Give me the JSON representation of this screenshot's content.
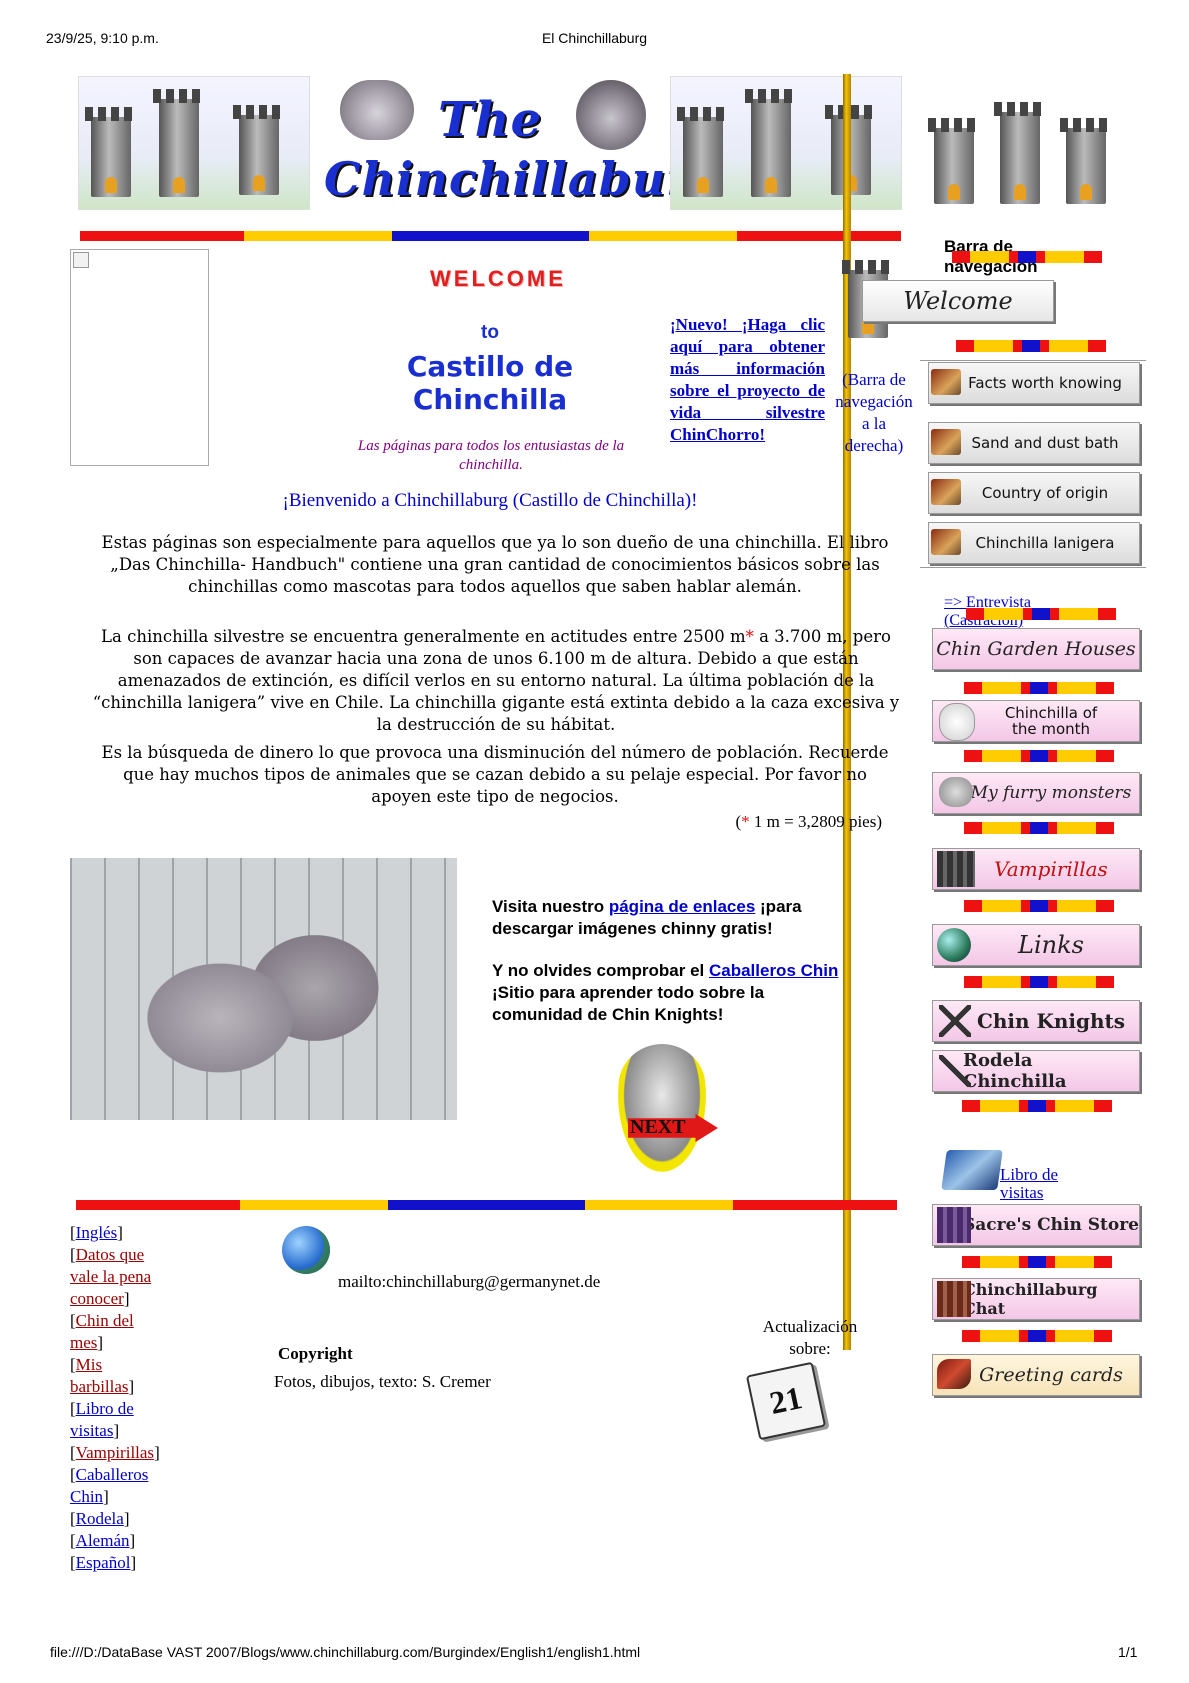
{
  "print": {
    "datetime": "23/9/25, 9:10 p.m.",
    "doc_title": "El Chinchillaburg",
    "url": "file:///D:/DataBase VAST 2007/Blogs/www.chinchillaburg.com/Burgindex/English1/english1.html",
    "page_num": "1/1"
  },
  "header": {
    "logo_line1": "The",
    "logo_line2": "Chinchillaburg"
  },
  "welcome": {
    "banner": "WELCOME",
    "to": "to",
    "castle_title": "Castillo de Chinchilla",
    "tagline": "Las páginas para todos los entusiastas de la chinchilla.",
    "news_link": "¡Nuevo! ¡Haga clic aquí para obtener más información sobre el proyecto de vida silvestre ChinChorro!",
    "nav_note": "(Barra de navegación a la derecha)",
    "greeting": "¡Bienvenido a Chinchillaburg (Castillo de Chinchilla)!"
  },
  "article": {
    "p1": "Estas páginas son especialmente para aquellos que ya lo son dueño de una chinchilla. El libro „Das Chinchilla- Handbuch\" contiene una gran cantidad de conocimientos básicos sobre las chinchillas como mascotas para todos aquellos que saben hablar alemán.",
    "p2_a": "La chinchilla silvestre se encuentra generalmente en actitudes entre 2500 m",
    "asterisk": "*",
    "p2_b": " a 3.700 m, pero son capaces de avanzar hacia una zona de unos 6.100 m de altura. Debido a que están amenazados de extinción, es difícil verlos en su entorno natural. La última población de la “chinchilla lanigera” vive en Chile. La chinchilla gigante está extinta debido a la caza excesiva y la destrucción de su hábitat.",
    "p3": "Es la búsqueda de dinero lo que provoca una disminución del número de población. Recuerde que hay muchos tipos de animales que se cazan debido a su pelaje especial. Por favor no apoyen este tipo de negocios.",
    "footnote_open": "(",
    "footnote_rest": " 1 m = 3,2809 pies)"
  },
  "promo": {
    "visit_prefix": "Visita nuestro ",
    "links_page": "página de enlaces",
    "visit_suffix": " ¡para descargar imágenes chinny gratis!",
    "knights_prefix": "Y no olvides comprobar el ",
    "knights_link": "Caballeros Chin",
    "knights_suffix": " ¡Sitio para aprender todo sobre la comunidad de Chin Knights!",
    "next_label": "NEXT"
  },
  "bottom_nav": [
    {
      "label": "Inglés",
      "visited": false
    },
    {
      "label": "Datos que vale la pena conocer",
      "visited": true
    },
    {
      "label": "Chin del mes",
      "visited": true
    },
    {
      "label": "Mis barbillas",
      "visited": true
    },
    {
      "label": "Libro de visitas",
      "visited": false
    },
    {
      "label": "Vampirillas",
      "visited": true
    },
    {
      "label": "Caballeros Chin",
      "visited": false
    },
    {
      "label": "Rodela",
      "visited": false
    },
    {
      "label": "Alemán",
      "visited": false
    },
    {
      "label": "Español",
      "visited": false
    }
  ],
  "footer": {
    "mailto": "mailto:chinchillaburg@germanynet.de",
    "copyright_label": "Copyright",
    "credits": "Fotos, dibujos, texto: S. Cremer",
    "update_label": "Actualización sobre:",
    "calendar_day": "21"
  },
  "sidebar": {
    "heading": "Barra de navegación",
    "welcome_btn": "Welcome",
    "facts": "Facts worth knowing",
    "sand": "Sand and dust bath",
    "country": "Country of origin",
    "lanigera": "Chinchilla lanigera",
    "interview": "=> Entrevista (Castración)",
    "garden": "Chin Garden Houses",
    "chin_month": "Chinchilla of the month",
    "furry": "My furry monsters",
    "vampirillas": "Vampirillas",
    "links": "Links",
    "knights": "Chin Knights",
    "rodela": "Rodela Chinchilla",
    "guestbook": "Libro de visitas",
    "store": "Sacre's Chin Store",
    "chat": "Chinchillaburg Chat",
    "cards": "Greeting cards"
  },
  "colors": {
    "link": "#0000cc",
    "visited": "#990000",
    "title_blue": "#1a2fd0",
    "tagline_purple": "#800080",
    "stripe_red": "#ee1111",
    "stripe_yellow": "#ffcc00",
    "stripe_blue": "#1111cc",
    "gold_bar": "#f5c400"
  }
}
